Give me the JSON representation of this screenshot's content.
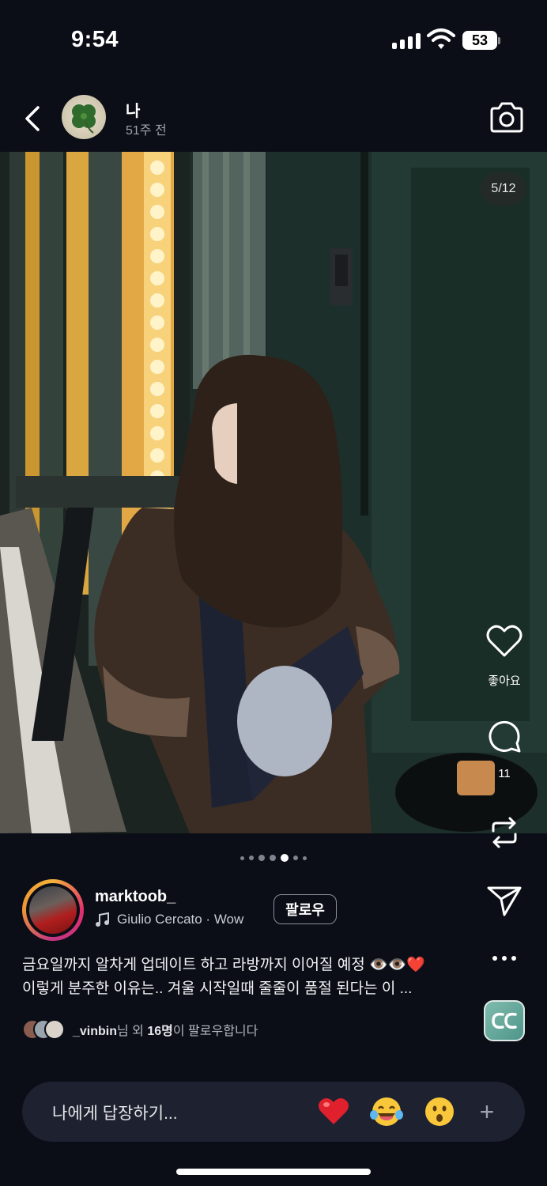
{
  "status_bar": {
    "time": "9:54",
    "battery": "53"
  },
  "header": {
    "name": "나",
    "time_ago": "51주 전"
  },
  "photo": {
    "counter": "5/12",
    "dots_total": 7,
    "dots_active": 4
  },
  "actions": {
    "like_label": "좋아요",
    "comment_count": "11"
  },
  "author": {
    "username": "marktoob_",
    "music": "Giulio Cercato · Wow",
    "follow_label": "팔로우"
  },
  "caption": {
    "line1": "금요일까지 알차게 업데이트 하고 라방까지 이어질 예정",
    "line2": "이렇게 분주한 이유는.. 겨울 시작일때 줄줄이 품절 된다는 이 ..."
  },
  "followers": {
    "user": "_vinbin",
    "middle": "님 외 ",
    "count": "16명",
    "suffix": "이 팔로우합니다"
  },
  "reply": {
    "placeholder": "나에게 답장하기..."
  },
  "colors": {
    "background": "#0b0e17",
    "reply_bar": "#1e2230",
    "like": "#e0212d"
  }
}
